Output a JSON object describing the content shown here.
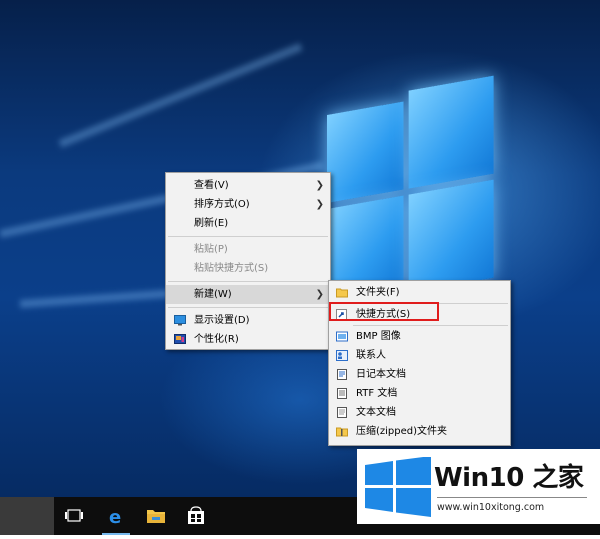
{
  "context_menu": {
    "items": [
      {
        "label": "查看(V)",
        "submenu": true,
        "disabled": false
      },
      {
        "label": "排序方式(O)",
        "submenu": true,
        "disabled": false
      },
      {
        "label": "刷新(E)",
        "submenu": false,
        "disabled": false
      },
      {
        "label": "粘贴(P)",
        "submenu": false,
        "disabled": true
      },
      {
        "label": "粘贴快捷方式(S)",
        "submenu": false,
        "disabled": true
      },
      {
        "label": "新建(W)",
        "submenu": true,
        "disabled": false,
        "highlighted": true
      },
      {
        "label": "显示设置(D)",
        "icon": "display-settings-icon",
        "disabled": false
      },
      {
        "label": "个性化(R)",
        "icon": "personalize-icon",
        "disabled": false
      }
    ]
  },
  "new_submenu": {
    "items": [
      {
        "label": "文件夹(F)",
        "icon": "folder-icon"
      },
      {
        "label": "快捷方式(S)",
        "icon": "shortcut-icon",
        "outlined": true
      },
      {
        "label": "BMP 图像",
        "icon": "bmp-image-icon"
      },
      {
        "label": "联系人",
        "icon": "contact-icon"
      },
      {
        "label": "日记本文档",
        "icon": "journal-document-icon"
      },
      {
        "label": "RTF 文档",
        "icon": "rtf-document-icon"
      },
      {
        "label": "文本文档",
        "icon": "text-document-icon"
      },
      {
        "label": "压缩(zipped)文件夹",
        "icon": "zip-folder-icon"
      }
    ]
  },
  "taskbar": {
    "buttons": [
      "task-view-icon",
      "edge-icon",
      "file-explorer-icon",
      "store-icon"
    ],
    "active": "edge-icon"
  },
  "watermark": {
    "title": "Win10 之家",
    "url": "www.win10xitong.com"
  },
  "colors": {
    "highlight_outline": "#e01c1c",
    "menu_bg": "#f2f2f2",
    "taskbar_bg": "#0d0d0d",
    "accent": "#1e88e5"
  }
}
